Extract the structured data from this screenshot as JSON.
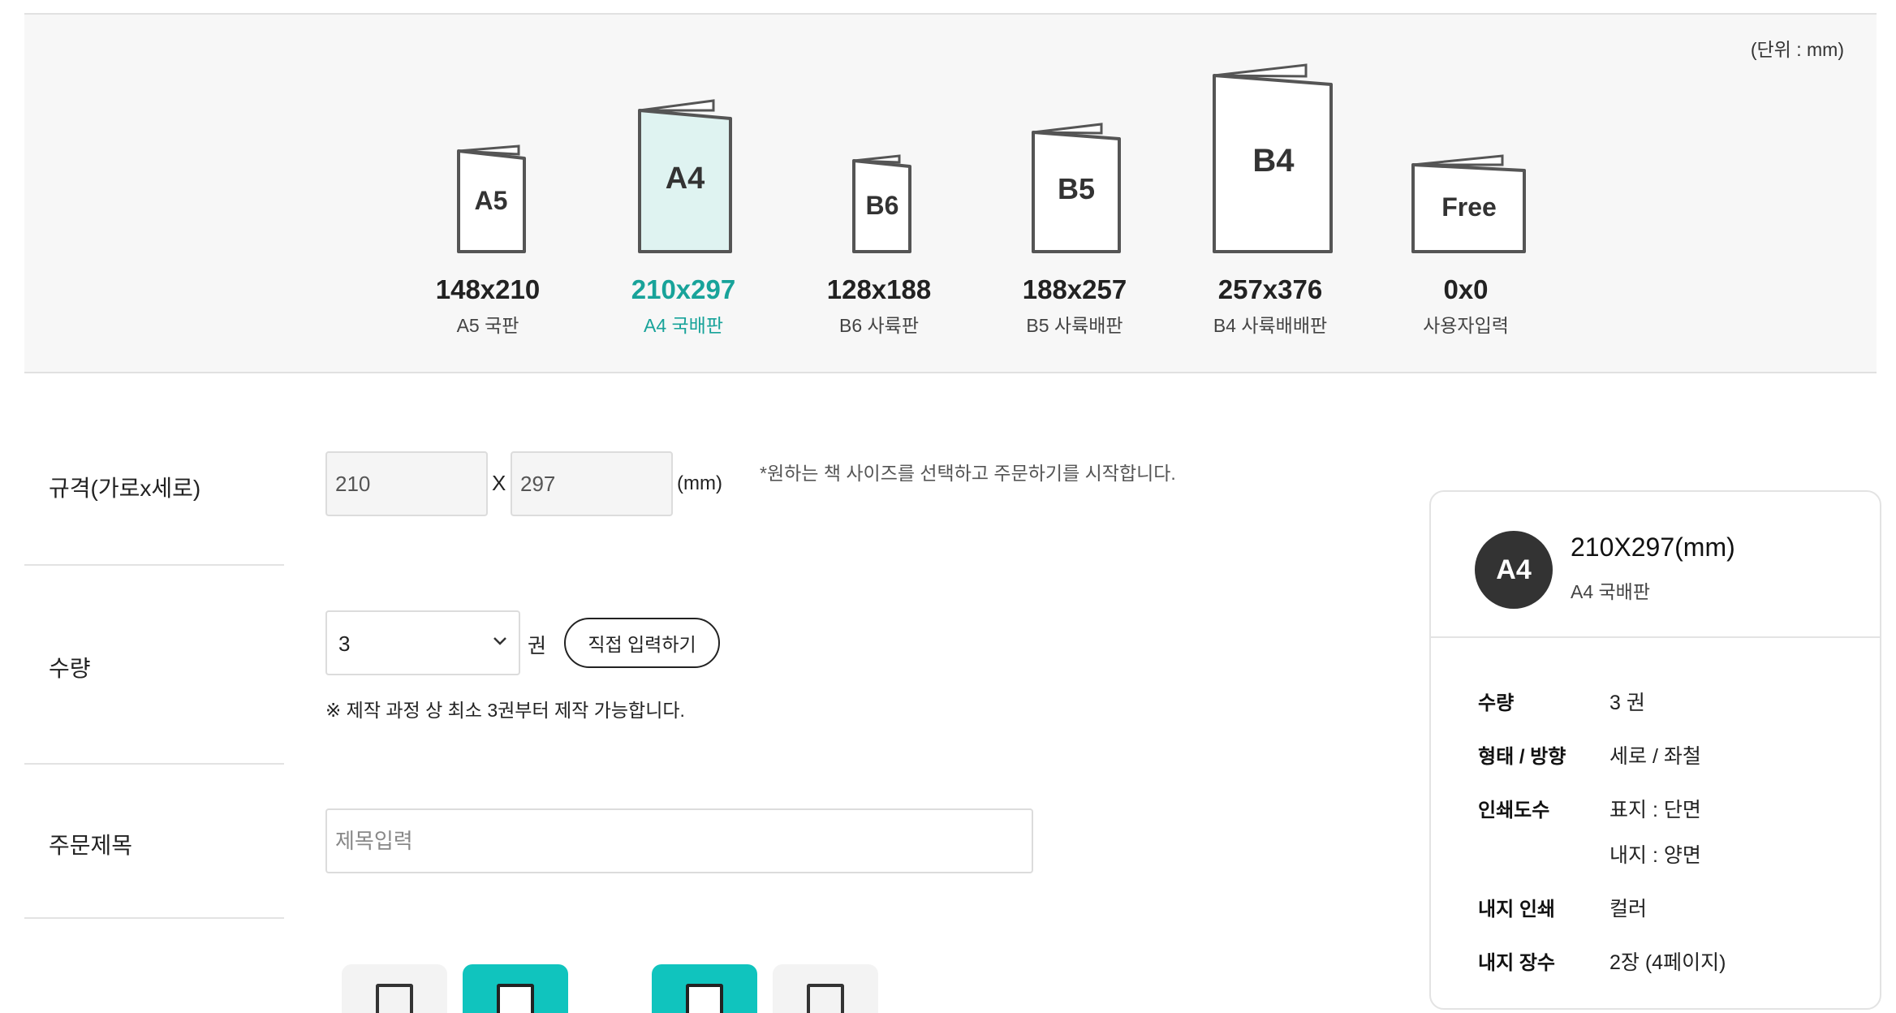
{
  "unit_note": "(단위 : mm)",
  "sizes": [
    {
      "code": "A5",
      "dims": "148x210",
      "name": "A5 국판"
    },
    {
      "code": "A4",
      "dims": "210x297",
      "name": "A4 국배판"
    },
    {
      "code": "B6",
      "dims": "128x188",
      "name": "B6 사륙판"
    },
    {
      "code": "B5",
      "dims": "188x257",
      "name": "B5 사륙배판"
    },
    {
      "code": "B4",
      "dims": "257x376",
      "name": "B4 사륙배배판"
    },
    {
      "code": "Free",
      "dims": "0x0",
      "name": "사용자입력"
    }
  ],
  "selected_size": "A4",
  "form": {
    "size_label": "규격(가로x세로)",
    "width_value": "210",
    "height_value": "297",
    "x_sep": "X",
    "mm_unit": "(mm)",
    "size_hint": "*원하는 책 사이즈를 선택하고 주문하기를 시작합니다.",
    "qty_label": "수량",
    "qty_value": "3",
    "qty_unit": "권",
    "direct_input_label": "직접 입력하기",
    "min_note": "※ 제작 과정 상 최소 3권부터 제작 가능합니다.",
    "title_label": "주문제목",
    "title_placeholder": "제목입력"
  },
  "colors": {
    "accent": "#18a39a",
    "selected_fill": "#dff3f1",
    "option_active": "#10c4be",
    "badge": "#333333"
  },
  "summary": {
    "badge": "A4",
    "title": "210X297(mm)",
    "subtitle": "A4 국배판",
    "rows": [
      {
        "label": "수량",
        "values": [
          "3 권"
        ]
      },
      {
        "label": "형태 / 방향",
        "values": [
          "세로 / 좌철"
        ]
      },
      {
        "label": "인쇄도수",
        "values": [
          "표지 : 단면",
          "내지 : 양면"
        ]
      },
      {
        "label": "내지 인쇄",
        "values": [
          "컬러"
        ]
      },
      {
        "label": "내지 장수",
        "values": [
          "2장 (4페이지)"
        ]
      }
    ]
  }
}
